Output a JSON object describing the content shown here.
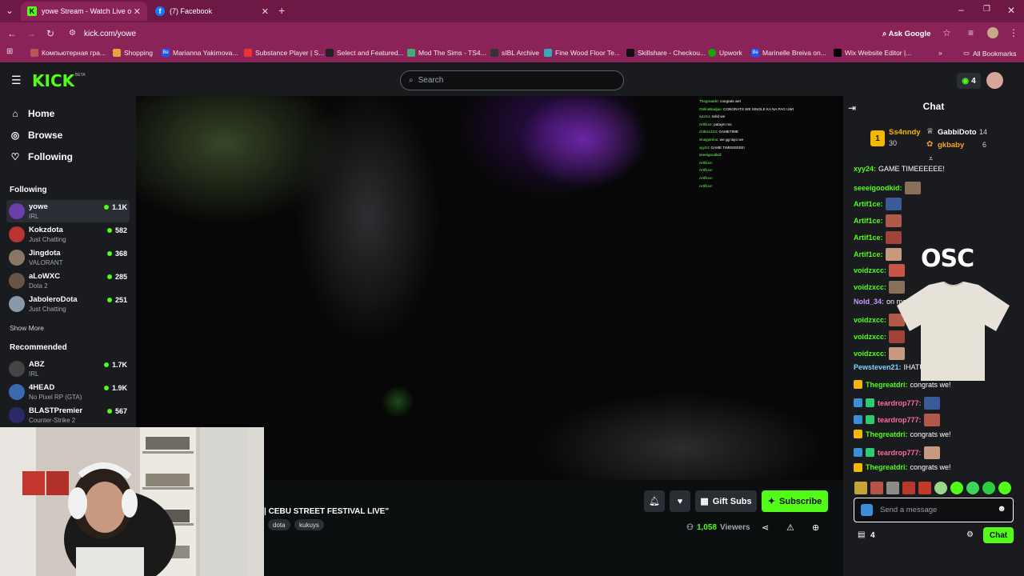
{
  "browser": {
    "tabs": [
      {
        "label": "yowe Stream - Watch Live o",
        "icon": "kick-favicon"
      },
      {
        "label": "(7) Facebook",
        "icon": "facebook-favicon"
      }
    ],
    "url": "kick.com/yowe",
    "ask_google": "Ask Google",
    "bookmarks": [
      "Компьютерная гра...",
      "Shopping",
      "Marianna Yakimova...",
      "Substance Player | S...",
      "Select and Featured...",
      "Mod The Sims - TS4...",
      "sIBL Archive",
      "Fine Wood Floor Te...",
      "Skillshare - Checkou...",
      "Upwork",
      "Marinelle Breiva on...",
      "Wix Website Editor |..."
    ],
    "all_bookmarks": "All Bookmarks"
  },
  "header": {
    "logo": "KICK",
    "beta": "BETA",
    "search_placeholder": "Search",
    "notif_count": "4"
  },
  "sidebar": {
    "nav": [
      {
        "label": "Home",
        "icon": "home-icon"
      },
      {
        "label": "Browse",
        "icon": "compass-icon"
      },
      {
        "label": "Following",
        "icon": "heart-icon"
      }
    ],
    "following_title": "Following",
    "following": [
      {
        "name": "yowe",
        "category": "IRL",
        "viewers": "1.1K",
        "color": "#6b3fa8"
      },
      {
        "name": "Kokzdota",
        "category": "Just Chatting",
        "viewers": "582",
        "color": "#b33"
      },
      {
        "name": "Jingdota",
        "category": "VALORANT",
        "viewers": "368",
        "color": "#887766"
      },
      {
        "name": "aLoWXC",
        "category": "Dota 2",
        "viewers": "285",
        "color": "#665544"
      },
      {
        "name": "JaboleroDota",
        "category": "Just Chatting",
        "viewers": "251",
        "color": "#8899aa"
      }
    ],
    "show_more": "Show More",
    "recommended_title": "Recommended",
    "recommended": [
      {
        "name": "ABZ",
        "category": "IRL",
        "viewers": "1.7K",
        "color": "#444"
      },
      {
        "name": "4HEAD",
        "category": "No Pixel RP (GTA)",
        "viewers": "1.9K",
        "color": "#3a6ab0"
      },
      {
        "name": "BLASTPremier",
        "category": "Counter-Strike 2",
        "viewers": "567",
        "color": "#2a2a6a"
      }
    ]
  },
  "video": {
    "overlay_chat": [
      {
        "user": "Thegreatdri",
        "text": ": congrats we!"
      },
      {
        "user": "OnlineBadjao",
        "text": ": CONGRATS WE SINGLE KA NA PAG UWI"
      },
      {
        "user": "w1zzu",
        "text": ": solid we"
      },
      {
        "user": "Artif1ce",
        "text": ": patayin mo"
      },
      {
        "user": "chibi11223",
        "text": ": GAMETIME"
      },
      {
        "user": "Snayperino",
        "text": ": we gg tayo we"
      },
      {
        "user": "xyy24",
        "text": ": GAME TIMEEEEEE!"
      },
      {
        "user": "seeeigoodkid",
        "text": ":"
      },
      {
        "user": "Artif1ce",
        "text": ":"
      },
      {
        "user": "Artif1ce",
        "text": ":"
      },
      {
        "user": "Artif1ce",
        "text": ":"
      },
      {
        "user": "Artif1ce",
        "text": ":"
      }
    ]
  },
  "stream": {
    "title": "| CEBU STREET FESTIVAL LIVE\"",
    "tags": [
      "dota",
      "kukuys"
    ],
    "gift_subs": "Gift Subs",
    "subscribe": "Subscribe",
    "viewer_count": "1,058",
    "viewers_label": "Viewers"
  },
  "chat": {
    "title": "Chat",
    "leaderboard": [
      {
        "name": "Ss4nndy",
        "score": "30",
        "rank": "1"
      },
      {
        "name": "GabbiDoto",
        "score": "14"
      },
      {
        "name": "gkbaby",
        "score": "6"
      }
    ],
    "messages": [
      {
        "user": "xyy24",
        "text": "GAME TIMEEEEEE!",
        "color": "#53fc18",
        "emote": false
      },
      {
        "user": "seeeigoodkid",
        "text": "",
        "color": "#53fc18",
        "emote": true
      },
      {
        "user": "Artif1ce",
        "text": "",
        "color": "#53fc18",
        "emote": true
      },
      {
        "user": "Artif1ce",
        "text": "",
        "color": "#53fc18",
        "emote": true
      },
      {
        "user": "Artif1ce",
        "text": "",
        "color": "#53fc18",
        "emote": true
      },
      {
        "user": "Artif1ce",
        "text": "",
        "color": "#53fc18",
        "emote": true
      },
      {
        "user": "voidzxcc",
        "text": "",
        "color": "#53fc18",
        "emote": true
      },
      {
        "user": "voidzxcc",
        "text": "",
        "color": "#53fc18",
        "emote": true
      },
      {
        "user": "Nold_34",
        "text": "on mo ligh",
        "color": "#c39bff",
        "emote": false
      },
      {
        "user": "voidzxcc",
        "text": "",
        "color": "#53fc18",
        "emote": true
      },
      {
        "user": "voidzxcc",
        "text": "",
        "color": "#53fc18",
        "emote": true
      },
      {
        "user": "voidzxcc",
        "text": "",
        "color": "#53fc18",
        "emote": true
      },
      {
        "user": "Pewsteven21",
        "text": "IHATU",
        "color": "#7fd4ff",
        "emote": false
      },
      {
        "user": "Thegreatdri",
        "text": "congrats we!",
        "color": "#53fc18",
        "emote": false
      },
      {
        "user": "teardrop777",
        "text": "",
        "color": "#ff6b9a",
        "emote": true
      },
      {
        "user": "teardrop777",
        "text": "",
        "color": "#ff6b9a",
        "emote": true
      },
      {
        "user": "Thegreatdri",
        "text": "congrats we!",
        "color": "#53fc18",
        "emote": false
      },
      {
        "user": "teardrop777",
        "text": "",
        "color": "#ff6b9a",
        "emote": true
      },
      {
        "user": "Thegreatdri",
        "text": "congrats we!",
        "color": "#53fc18",
        "emote": false
      }
    ],
    "input_placeholder": "Send a message",
    "points": "4",
    "send_label": "Chat",
    "ad_brand": "OSC"
  },
  "colors": {
    "accent": "#53fc18",
    "tab_bar": "#6e1846",
    "toolbar": "#8a2358"
  }
}
